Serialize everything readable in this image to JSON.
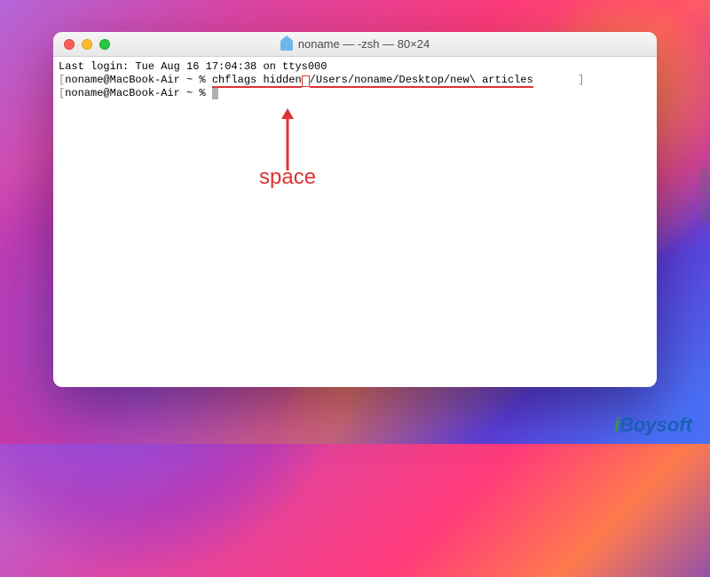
{
  "window": {
    "title": "noname — -zsh — 80×24"
  },
  "terminal": {
    "lastLogin": "Last login: Tue Aug 16 17:04:38 on ttys000",
    "prompt1Prefix": "[",
    "prompt1User": "noname@MacBook-Air ~ % ",
    "cmdPart1": "chflags hidden",
    "cmdPart2": "/Users/noname/Desktop/new\\ articles",
    "prompt1Suffix": "]",
    "prompt2Prefix": "[",
    "prompt2User": "noname@MacBook-Air ~ % "
  },
  "annotation": {
    "label": "space"
  },
  "watermarks": {
    "side": "wsxdn.com",
    "logo_prefix": "i",
    "logo_rest": "Boysoft"
  }
}
